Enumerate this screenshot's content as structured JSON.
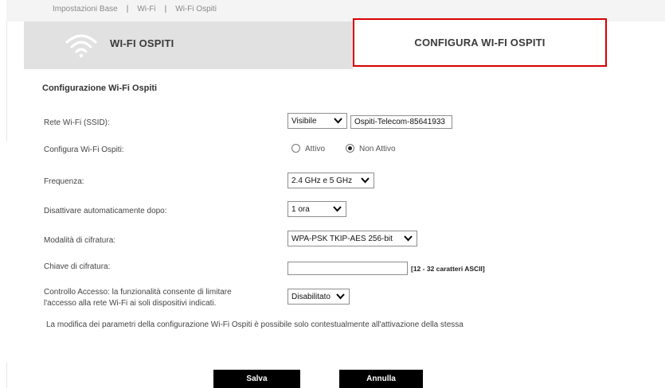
{
  "breadcrumb": [
    "Impostazioni Base",
    "Wi-Fi",
    "Wi-Fi Ospiti"
  ],
  "header": {
    "left_title": "WI-FI OSPITI",
    "right_title": "CONFIGURA WI-FI OSPITI",
    "highlight_color": "#d60000",
    "icon": "wifi-icon"
  },
  "section_title": "Configurazione Wi-Fi Ospiti",
  "form": {
    "ssid": {
      "label": "Rete Wi-Fi (SSID):",
      "visibility": "Visibile",
      "value": "Ospiti-Telecom-85641933"
    },
    "guest": {
      "label": "Configura Wi-Fi Ospiti:",
      "option_on": "Attivo",
      "option_off": "Non Attivo",
      "selected": "Non Attivo"
    },
    "frequency": {
      "label": "Frequenza:",
      "value": "2.4 GHz e 5 GHz"
    },
    "auto_off": {
      "label": "Disattivare automaticamente dopo:",
      "value": "1 ora"
    },
    "encryption_mode": {
      "label": "Modalità di cifratura:",
      "value": "WPA-PSK TKIP-AES 256-bit"
    },
    "encryption_key": {
      "label": "Chiave di cifratura:",
      "value": "",
      "hint": "[12 - 32 caratteri ASCII]"
    },
    "access_control": {
      "label_line1": "Controllo Accesso: la funzionalità consente di limitare",
      "label_line2": "l'accesso alla rete Wi-Fi ai soli dispositivi indicati.",
      "value": "Disabilitato"
    }
  },
  "note": "La modifica dei parametri della configurazione Wi-Fi Ospiti è possibile solo contestualmente all'attivazione della stessa",
  "buttons": {
    "save": "Salva",
    "cancel": "Annulla"
  }
}
